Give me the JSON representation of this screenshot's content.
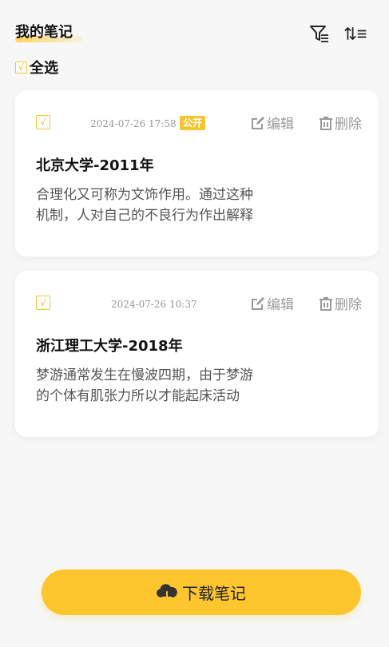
{
  "header": {
    "title": "我的笔记",
    "filter_icon": "filter-icon",
    "sort_icon": "sort-icon"
  },
  "select_all": {
    "checkbox_mark": "√",
    "label": "全选"
  },
  "notes": [
    {
      "checkbox_mark": "√",
      "time": "2024-07-26 17:58",
      "badge": "公开",
      "edit_label": "编辑",
      "delete_label": "删除",
      "title": "北京大学-2011年",
      "body": "合理化又可称为文饰作用。通过这种机制，人对自己的不良行为作出解释"
    },
    {
      "checkbox_mark": "√",
      "time": "2024-07-26 10:37",
      "badge": "",
      "edit_label": "编辑",
      "delete_label": "删除",
      "title": "浙江理工大学-2018年",
      "body": "梦游通常发生在慢波四期，由于梦游的个体有肌张力所以才能起床活动"
    }
  ],
  "footer": {
    "download_label": "下载笔记",
    "download_icon": "cloud-download-icon"
  },
  "colors": {
    "accent": "#fdc62f",
    "badge": "#f4c431",
    "muted": "#9a9a9a"
  }
}
